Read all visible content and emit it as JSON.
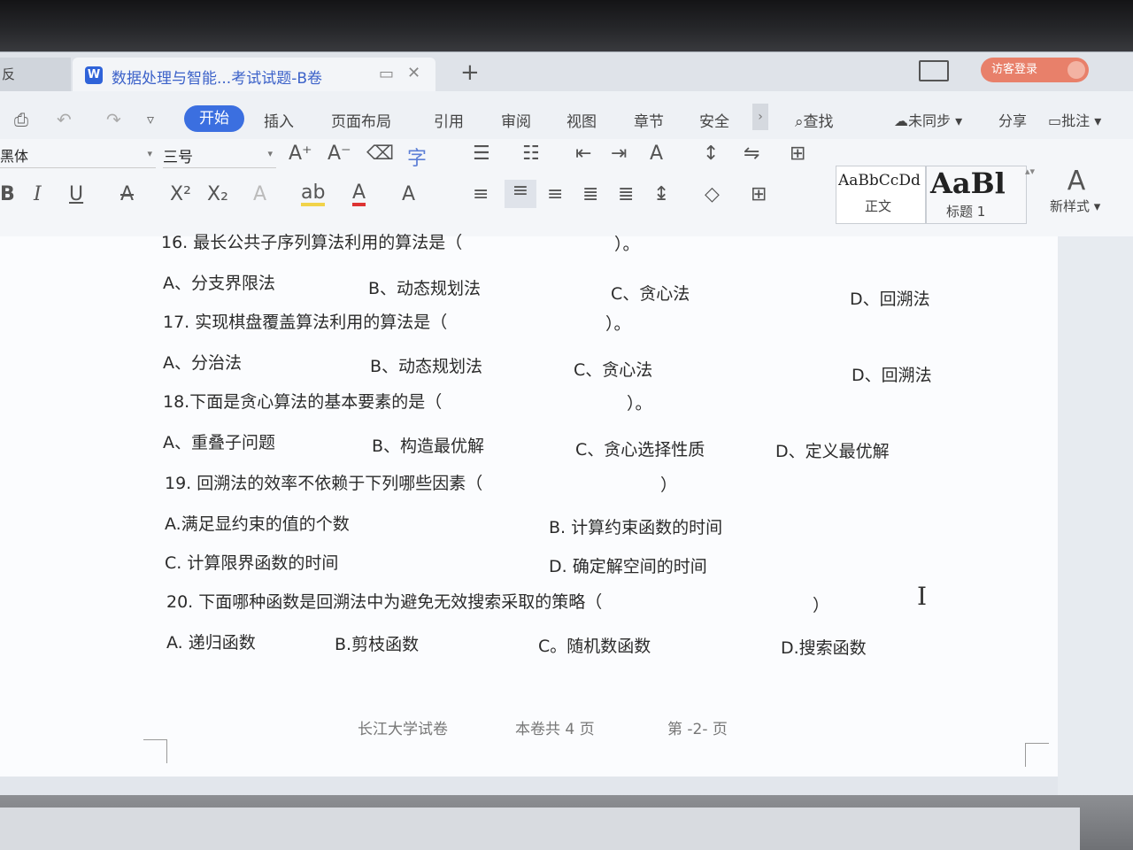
{
  "tabs": {
    "first_tab_label": "反",
    "doc_tab_title": "数据处理与智能...考试试题-B卷",
    "new_tab_glyph": "+",
    "login_label": "访客登录"
  },
  "menu": {
    "items": [
      "开始",
      "插入",
      "页面布局",
      "引用",
      "审阅",
      "视图",
      "章节",
      "安全"
    ],
    "search_label": "查找",
    "sync_label": "未同步",
    "share_label": "分享",
    "comment_label": "批注"
  },
  "ribbon": {
    "font_family_value": "黑体",
    "font_size_value": "三号",
    "styles": [
      {
        "sample": "AaBbCcDd",
        "name": "正文"
      },
      {
        "sample": "AaBl",
        "name": "标题 1"
      }
    ],
    "new_style_label": "新样式"
  },
  "document": {
    "questions": [
      {
        "number": "16.",
        "text": "最长公共子序列算法利用的算法是（",
        "close": "）。",
        "options": [
          "A、分支界限法",
          "B、动态规划法",
          "C、贪心法",
          "D、回溯法"
        ]
      },
      {
        "number": "17.",
        "text": "实现棋盘覆盖算法利用的算法是（",
        "close": "）。",
        "options": [
          "A、分治法",
          "B、动态规划法",
          "C、贪心法",
          "D、回溯法"
        ]
      },
      {
        "number": "18.",
        "text": "下面是贪心算法的基本要素的是（",
        "close": "）。",
        "options": [
          "A、重叠子问题",
          "B、构造最优解",
          "C、贪心选择性质",
          "D、定义最优解"
        ]
      },
      {
        "number": "19.",
        "text": "回溯法的效率不依赖于下列哪些因素（",
        "close": "）",
        "options": [
          "A.满足显约束的值的个数",
          "B. 计算约束函数的时间",
          "C. 计算限界函数的时间",
          "D. 确定解空间的时间"
        ]
      },
      {
        "number": "20.",
        "text": "下面哪种函数是回溯法中为避免无效搜索采取的策略（",
        "close": "）",
        "options": [
          "A. 递归函数",
          "B.剪枝函数",
          "C。随机数函数",
          "D.搜索函数"
        ]
      }
    ],
    "footer": {
      "school": "长江大学试卷",
      "total_pages": "本卷共 4 页",
      "page_no": "第 -2- 页"
    }
  }
}
